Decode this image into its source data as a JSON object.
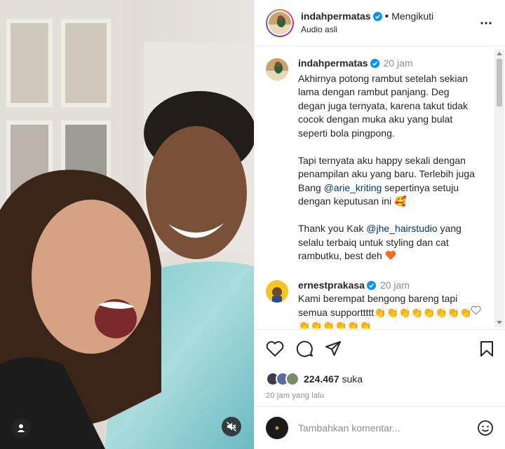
{
  "post": {
    "author": "indahpermatas",
    "follow_label": "Mengikuti",
    "audio_label": "Audio asli",
    "caption": {
      "username": "indahpermatas",
      "time": "20 jam",
      "paragraphs": [
        {
          "before": "Akhirnya potong rambut setelah sekian lama dengan rambut panjang. Deg degan juga ternyata, karena takut tidak cocok dengan muka aku yang bulat seperti bola pingpong.",
          "mention": "",
          "after": ""
        },
        {
          "before": "Tapi ternyata aku happy sekali dengan penampilan aku yang baru. Terlebih juga Bang ",
          "mention": "@arie_kriting",
          "after": " sepertinya setuju dengan keputusan ini 🥰"
        },
        {
          "before": "Thank you Kak ",
          "mention": "@jhe_hairstudio",
          "after": " yang selalu terbaiq untuk styling dan cat rambutku, best deh"
        }
      ]
    },
    "comments": [
      {
        "username": "ernestprakasa",
        "time": "20 jam",
        "text": "Kami berempat bengong bareng tapi semua supporttttt👏👏👏👏👏👏👏👏👏👏👏👏👏👏"
      }
    ],
    "likes_count": "224.467",
    "likes_label": "suka",
    "posted_ago": "20 jam yang lalu",
    "comment_placeholder": "Tambahkan komentar...",
    "colors": {
      "verified": "#0095f6",
      "mention": "#00376b",
      "heart": "#f26d21"
    },
    "icons": [
      "more-options-icon",
      "like-icon",
      "comment-icon",
      "share-icon",
      "save-icon",
      "emoji-icon",
      "mute-icon",
      "user-tag-icon",
      "verified-icon"
    ]
  }
}
